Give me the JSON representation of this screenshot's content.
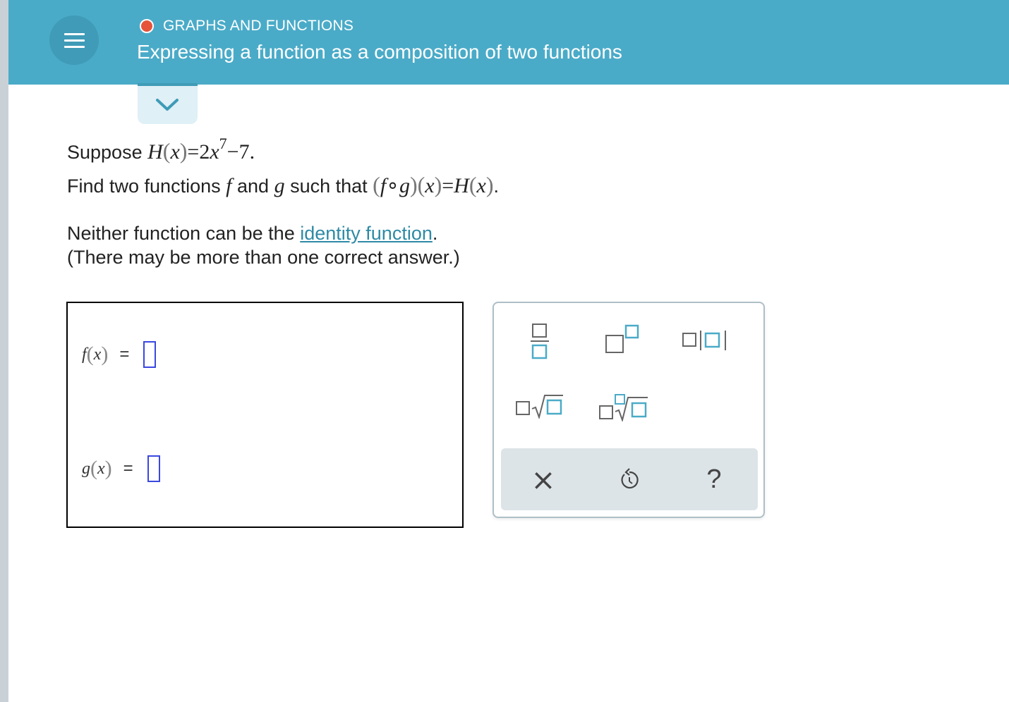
{
  "header": {
    "topic": "GRAPHS AND FUNCTIONS",
    "title": "Expressing a function as a composition of two functions",
    "colors": {
      "bar": "#4aabc8",
      "topic_dot": "#e5533b"
    }
  },
  "problem": {
    "line1_prefix": "Suppose",
    "H": "H",
    "x": "x",
    "eq_rhs": "=2",
    "exp": "7",
    "minus7": "−7.",
    "line2_prefix": "Find two functions",
    "f": "f",
    "and": "and",
    "g": "g",
    "such_that": "such that",
    "compose": "∘",
    "eq": "=",
    "period": ".",
    "line3_prefix": "Neither function can be the",
    "link_text": "identity function",
    "line3_suffix": ".",
    "line4": "(There may be more than one correct answer.)"
  },
  "answer": {
    "f_label": "f",
    "g_label": "g",
    "x": "x",
    "equals": "=",
    "f_value": "",
    "g_value": ""
  },
  "palette": {
    "tools": [
      "fraction-tool",
      "superscript-tool",
      "absolute-value-tool",
      "square-root-tool",
      "nth-root-tool"
    ],
    "actions": {
      "clear": "×",
      "undo": "undo-icon",
      "help": "?"
    },
    "accent": "#4aabc8"
  }
}
